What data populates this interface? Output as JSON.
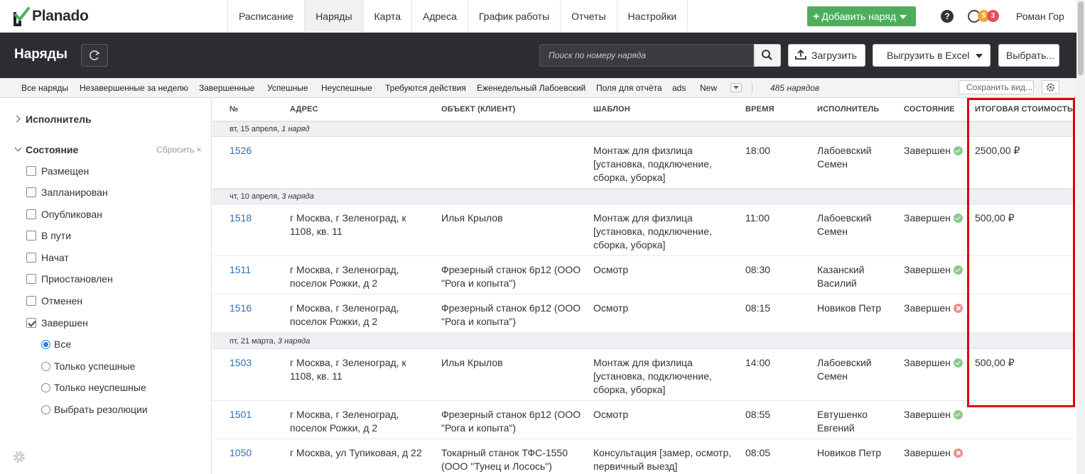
{
  "app": {
    "logo": "Planado",
    "user": "Роман Гор",
    "notif_counts": [
      "5",
      "3"
    ]
  },
  "nav": {
    "tabs": [
      "Расписание",
      "Наряды",
      "Карта",
      "Адреса",
      "График работы",
      "Отчеты",
      "Настройки"
    ],
    "active": "Наряды",
    "add_button": "Добавить наряд"
  },
  "header": {
    "title": "Наряды",
    "search_placeholder": "Поиск по номеру наряда",
    "upload": "Загрузить",
    "export": "Выгрузить в Excel",
    "select": "Выбрать..."
  },
  "filters": {
    "tabs": [
      "Все наряды",
      "Незавершенные за неделю",
      "Завершенные",
      "Успешные",
      "Неуспешные",
      "Требуются действия",
      "Еженедельный Лабоевский",
      "Поля для отчёта",
      "ads",
      "New"
    ],
    "count": "485 нарядов",
    "save_view": "Сохранить вид..."
  },
  "sidebar": {
    "executor_title": "Исполнитель",
    "state_title": "Состояние",
    "reset": "Сбросить ×",
    "states": [
      {
        "label": "Размещен",
        "checked": false
      },
      {
        "label": "Запланирован",
        "checked": false
      },
      {
        "label": "Опубликован",
        "checked": false
      },
      {
        "label": "В пути",
        "checked": false
      },
      {
        "label": "Начат",
        "checked": false
      },
      {
        "label": "Приостановлен",
        "checked": false
      },
      {
        "label": "Отменен",
        "checked": false
      },
      {
        "label": "Завершен",
        "checked": true
      }
    ],
    "resolutions": [
      {
        "label": "Все",
        "selected": true
      },
      {
        "label": "Только успешные",
        "selected": false
      },
      {
        "label": "Только неуспешные",
        "selected": false
      },
      {
        "label": "Выбрать резолюции",
        "selected": false
      }
    ]
  },
  "table": {
    "columns": [
      "№",
      "АДРЕС",
      "ОБЪЕКТ (КЛИЕНТ)",
      "ШАБЛОН",
      "ВРЕМЯ",
      "ИСПОЛНИТЕЛЬ",
      "СОСТОЯНИЕ",
      "ИТОГОВАЯ СТОИМОСТЬ"
    ],
    "groups": [
      {
        "date": "вт, 15 апреля,",
        "count": "1 наряд"
      },
      {
        "date": "чт, 10 апреля,",
        "count": "3 наряда"
      },
      {
        "date": "пт, 21 марта,",
        "count": "3 наряда"
      }
    ],
    "rows": [
      {
        "num": "1526",
        "address": "",
        "object": "",
        "template": "Монтаж для физлица [установка, подключение, сборка, уборка]",
        "time": "18:00",
        "executor": "Лабоевский Семен",
        "state": "Завершен",
        "ok": true,
        "cost": "2500,00 ₽"
      },
      {
        "num": "1518",
        "address": "г Москва, г Зеленоград, к 1108, кв. 11",
        "object": "Илья Крылов",
        "template": "Монтаж для физлица [установка, подключение, сборка, уборка]",
        "time": "11:00",
        "executor": "Лабоевский Семен",
        "state": "Завершен",
        "ok": true,
        "cost": "500,00 ₽"
      },
      {
        "num": "1511",
        "address": "г Москва, г Зеленоград, поселок Рожки, д 2",
        "object": "Фрезерный станок 6р12 (ООО \"Рога и копыта\")",
        "template": "Осмотр",
        "time": "08:30",
        "executor": "Казанский Василий",
        "state": "Завершен",
        "ok": true,
        "cost": ""
      },
      {
        "num": "1516",
        "address": "г Москва, г Зеленоград, поселок Рожки, д 2",
        "object": "Фрезерный станок 6р12 (ООО \"Рога и копыта\")",
        "template": "Осмотр",
        "time": "08:15",
        "executor": "Новиков Петр",
        "state": "Завершен",
        "ok": false,
        "cost": ""
      },
      {
        "num": "1503",
        "address": "г Москва, г Зеленоград, к 1108, кв. 11",
        "object": "Илья Крылов",
        "template": "Монтаж для физлица [установка, подключение, сборка, уборка]",
        "time": "14:00",
        "executor": "Лабоевский Семен",
        "state": "Завершен",
        "ok": true,
        "cost": "500,00 ₽"
      },
      {
        "num": "1501",
        "address": "г Москва, г Зеленоград, поселок Рожки, д 2",
        "object": "Фрезерный станок 6р12 (ООО \"Рога и копыта\")",
        "template": "Осмотр",
        "time": "08:55",
        "executor": "Евтушенко Евгений",
        "state": "Завершен",
        "ok": true,
        "cost": ""
      },
      {
        "num": "1050",
        "address": "г Москва, ул Тупиковая, д 22",
        "object": "Токарный станок ТФС-1550 (ООО \"Тунец и Лосось\")",
        "template": "Консультация [замер, осмотр, первичный выезд]",
        "time": "08:05",
        "executor": "Новиков Петр",
        "state": "Завершен",
        "ok": false,
        "cost": ""
      }
    ]
  }
}
